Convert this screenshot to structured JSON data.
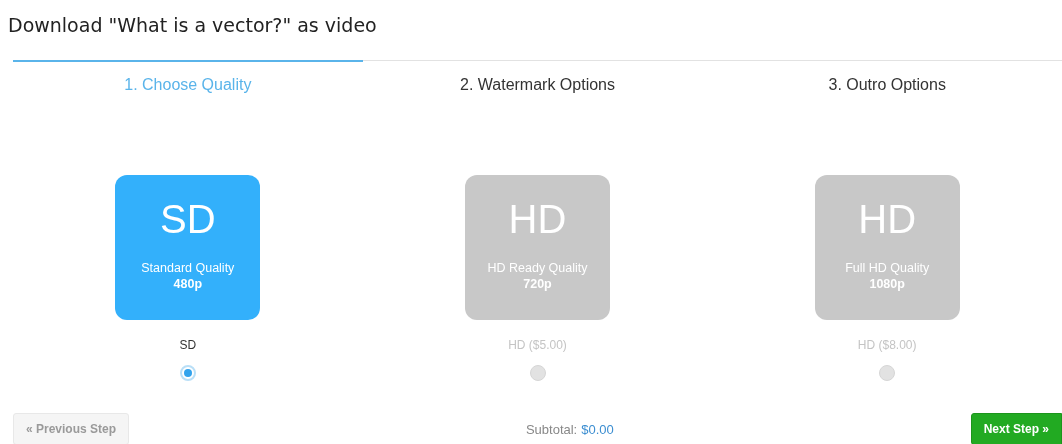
{
  "title": "Download \"What is a vector?\" as video",
  "steps": [
    {
      "label": "1. Choose Quality",
      "selected": true
    },
    {
      "label": "2. Watermark Options",
      "selected": false
    },
    {
      "label": "3. Outro Options",
      "selected": false
    }
  ],
  "options": [
    {
      "badge": "SD",
      "name": "Standard Quality",
      "resolution": "480p",
      "label": "SD",
      "selected": true
    },
    {
      "badge": "HD",
      "name": "HD Ready Quality",
      "resolution": "720p",
      "label": "HD ($5.00)",
      "selected": false
    },
    {
      "badge": "HD",
      "name": "Full HD Quality",
      "resolution": "1080p",
      "label": "HD ($8.00)",
      "selected": false
    }
  ],
  "previous_button": {
    "label": "« Previous Step",
    "disabled": true
  },
  "subtotal": {
    "label": "Subtotal:",
    "amount": "$0.00"
  },
  "next_button": {
    "label": "Next Step »",
    "disabled": false
  }
}
